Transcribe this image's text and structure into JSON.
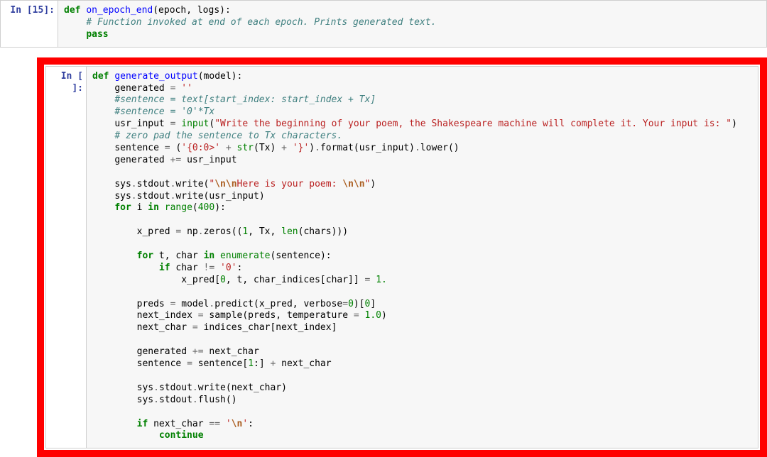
{
  "cells": [
    {
      "prompt": "In [15]:",
      "lines": [
        {
          "t": "l1",
          "indent": 0
        },
        {
          "t": "l2",
          "indent": 4
        },
        {
          "t": "l3",
          "indent": 4
        }
      ]
    },
    {
      "prompt": "In [ ]:",
      "lines": [
        {
          "t": "b1",
          "indent": 0
        },
        {
          "t": "b2",
          "indent": 4
        },
        {
          "t": "b3",
          "indent": 4
        },
        {
          "t": "b4",
          "indent": 4
        },
        {
          "t": "b5",
          "indent": 4
        },
        {
          "t": "b6",
          "indent": 4
        },
        {
          "t": "b7",
          "indent": 4
        },
        {
          "t": "b8",
          "indent": 4
        },
        {
          "t": "blk",
          "indent": 0
        },
        {
          "t": "b9",
          "indent": 4
        },
        {
          "t": "b10",
          "indent": 4
        },
        {
          "t": "b11",
          "indent": 4
        },
        {
          "t": "blk",
          "indent": 0
        },
        {
          "t": "b12",
          "indent": 8
        },
        {
          "t": "blk",
          "indent": 0
        },
        {
          "t": "b13",
          "indent": 8
        },
        {
          "t": "b14",
          "indent": 12
        },
        {
          "t": "b15",
          "indent": 16
        },
        {
          "t": "blk",
          "indent": 0
        },
        {
          "t": "b16",
          "indent": 8
        },
        {
          "t": "b17",
          "indent": 8
        },
        {
          "t": "b18",
          "indent": 8
        },
        {
          "t": "blk",
          "indent": 0
        },
        {
          "t": "b19",
          "indent": 8
        },
        {
          "t": "b20",
          "indent": 8
        },
        {
          "t": "blk",
          "indent": 0
        },
        {
          "t": "b21",
          "indent": 8
        },
        {
          "t": "b22",
          "indent": 8
        },
        {
          "t": "blk",
          "indent": 0
        },
        {
          "t": "b23",
          "indent": 8
        },
        {
          "t": "b24",
          "indent": 12
        }
      ]
    }
  ],
  "tokens": {
    "blk": [],
    "l1": [
      {
        "c": "kw",
        "v": "def"
      },
      {
        "c": "pl",
        "v": " "
      },
      {
        "c": "fn",
        "v": "on_epoch_end"
      },
      {
        "c": "pl",
        "v": "(epoch, logs):"
      }
    ],
    "l2": [
      {
        "c": "cm",
        "v": "# Function invoked at end of each epoch. Prints generated text."
      }
    ],
    "l3": [
      {
        "c": "kw",
        "v": "pass"
      }
    ],
    "b1": [
      {
        "c": "kw",
        "v": "def"
      },
      {
        "c": "pl",
        "v": " "
      },
      {
        "c": "fn",
        "v": "generate_output"
      },
      {
        "c": "pl",
        "v": "(model):"
      }
    ],
    "b2": [
      {
        "c": "pl",
        "v": "generated "
      },
      {
        "c": "pun",
        "v": "="
      },
      {
        "c": "pl",
        "v": " "
      },
      {
        "c": "st",
        "v": "''"
      }
    ],
    "b3": [
      {
        "c": "cm",
        "v": "#sentence = text[start_index: start_index + Tx]"
      }
    ],
    "b4": [
      {
        "c": "cm",
        "v": "#sentence = '0'*Tx"
      }
    ],
    "b5": [
      {
        "c": "pl",
        "v": "usr_input "
      },
      {
        "c": "pun",
        "v": "="
      },
      {
        "c": "pl",
        "v": " "
      },
      {
        "c": "bi",
        "v": "input"
      },
      {
        "c": "pl",
        "v": "("
      },
      {
        "c": "st",
        "v": "\"Write the beginning of your poem, the Shakespeare machine will complete it. Your input is: \""
      },
      {
        "c": "pl",
        "v": ")"
      }
    ],
    "b6": [
      {
        "c": "cm",
        "v": "# zero pad the sentence to Tx characters."
      }
    ],
    "b7": [
      {
        "c": "pl",
        "v": "sentence "
      },
      {
        "c": "pun",
        "v": "="
      },
      {
        "c": "pl",
        "v": " ("
      },
      {
        "c": "st",
        "v": "'{0:0>'"
      },
      {
        "c": "pl",
        "v": " "
      },
      {
        "c": "pun",
        "v": "+"
      },
      {
        "c": "pl",
        "v": " "
      },
      {
        "c": "bi",
        "v": "str"
      },
      {
        "c": "pl",
        "v": "(Tx) "
      },
      {
        "c": "pun",
        "v": "+"
      },
      {
        "c": "pl",
        "v": " "
      },
      {
        "c": "st",
        "v": "'}'"
      },
      {
        "c": "pl",
        "v": ")"
      },
      {
        "c": "pun",
        "v": "."
      },
      {
        "c": "pl",
        "v": "format(usr_input)"
      },
      {
        "c": "pun",
        "v": "."
      },
      {
        "c": "pl",
        "v": "lower()"
      }
    ],
    "b8": [
      {
        "c": "pl",
        "v": "generated "
      },
      {
        "c": "pun",
        "v": "+="
      },
      {
        "c": "pl",
        "v": " usr_input"
      }
    ],
    "b9": [
      {
        "c": "pl",
        "v": "sys"
      },
      {
        "c": "pun",
        "v": "."
      },
      {
        "c": "pl",
        "v": "stdout"
      },
      {
        "c": "pun",
        "v": "."
      },
      {
        "c": "pl",
        "v": "write("
      },
      {
        "c": "st",
        "v": "\""
      },
      {
        "c": "se",
        "v": "\\n\\n"
      },
      {
        "c": "st",
        "v": "Here is your poem: "
      },
      {
        "c": "se",
        "v": "\\n\\n"
      },
      {
        "c": "st",
        "v": "\""
      },
      {
        "c": "pl",
        "v": ")"
      }
    ],
    "b10": [
      {
        "c": "pl",
        "v": "sys"
      },
      {
        "c": "pun",
        "v": "."
      },
      {
        "c": "pl",
        "v": "stdout"
      },
      {
        "c": "pun",
        "v": "."
      },
      {
        "c": "pl",
        "v": "write(usr_input)"
      }
    ],
    "b11": [
      {
        "c": "kw",
        "v": "for"
      },
      {
        "c": "pl",
        "v": " i "
      },
      {
        "c": "kw",
        "v": "in"
      },
      {
        "c": "pl",
        "v": " "
      },
      {
        "c": "bi",
        "v": "range"
      },
      {
        "c": "pl",
        "v": "("
      },
      {
        "c": "num",
        "v": "400"
      },
      {
        "c": "pl",
        "v": "):"
      }
    ],
    "b12": [
      {
        "c": "pl",
        "v": "x_pred "
      },
      {
        "c": "pun",
        "v": "="
      },
      {
        "c": "pl",
        "v": " np"
      },
      {
        "c": "pun",
        "v": "."
      },
      {
        "c": "pl",
        "v": "zeros(("
      },
      {
        "c": "num",
        "v": "1"
      },
      {
        "c": "pl",
        "v": ", Tx, "
      },
      {
        "c": "bi",
        "v": "len"
      },
      {
        "c": "pl",
        "v": "(chars)))"
      }
    ],
    "b13": [
      {
        "c": "kw",
        "v": "for"
      },
      {
        "c": "pl",
        "v": " t, char "
      },
      {
        "c": "kw",
        "v": "in"
      },
      {
        "c": "pl",
        "v": " "
      },
      {
        "c": "bi",
        "v": "enumerate"
      },
      {
        "c": "pl",
        "v": "(sentence):"
      }
    ],
    "b14": [
      {
        "c": "kw",
        "v": "if"
      },
      {
        "c": "pl",
        "v": " char "
      },
      {
        "c": "pun",
        "v": "!="
      },
      {
        "c": "pl",
        "v": " "
      },
      {
        "c": "st",
        "v": "'0'"
      },
      {
        "c": "pl",
        "v": ":"
      }
    ],
    "b15": [
      {
        "c": "pl",
        "v": "x_pred["
      },
      {
        "c": "num",
        "v": "0"
      },
      {
        "c": "pl",
        "v": ", t, char_indices[char]] "
      },
      {
        "c": "pun",
        "v": "="
      },
      {
        "c": "pl",
        "v": " "
      },
      {
        "c": "num",
        "v": "1."
      }
    ],
    "b16": [
      {
        "c": "pl",
        "v": "preds "
      },
      {
        "c": "pun",
        "v": "="
      },
      {
        "c": "pl",
        "v": " model"
      },
      {
        "c": "pun",
        "v": "."
      },
      {
        "c": "pl",
        "v": "predict(x_pred, verbose"
      },
      {
        "c": "pun",
        "v": "="
      },
      {
        "c": "num",
        "v": "0"
      },
      {
        "c": "pl",
        "v": ")["
      },
      {
        "c": "num",
        "v": "0"
      },
      {
        "c": "pl",
        "v": "]"
      }
    ],
    "b17": [
      {
        "c": "pl",
        "v": "next_index "
      },
      {
        "c": "pun",
        "v": "="
      },
      {
        "c": "pl",
        "v": " sample(preds, temperature "
      },
      {
        "c": "pun",
        "v": "="
      },
      {
        "c": "pl",
        "v": " "
      },
      {
        "c": "num",
        "v": "1.0"
      },
      {
        "c": "pl",
        "v": ")"
      }
    ],
    "b18": [
      {
        "c": "pl",
        "v": "next_char "
      },
      {
        "c": "pun",
        "v": "="
      },
      {
        "c": "pl",
        "v": " indices_char[next_index]"
      }
    ],
    "b19": [
      {
        "c": "pl",
        "v": "generated "
      },
      {
        "c": "pun",
        "v": "+="
      },
      {
        "c": "pl",
        "v": " next_char"
      }
    ],
    "b20": [
      {
        "c": "pl",
        "v": "sentence "
      },
      {
        "c": "pun",
        "v": "="
      },
      {
        "c": "pl",
        "v": " sentence["
      },
      {
        "c": "num",
        "v": "1"
      },
      {
        "c": "pl",
        "v": ":] "
      },
      {
        "c": "pun",
        "v": "+"
      },
      {
        "c": "pl",
        "v": " next_char"
      }
    ],
    "b21": [
      {
        "c": "pl",
        "v": "sys"
      },
      {
        "c": "pun",
        "v": "."
      },
      {
        "c": "pl",
        "v": "stdout"
      },
      {
        "c": "pun",
        "v": "."
      },
      {
        "c": "pl",
        "v": "write(next_char)"
      }
    ],
    "b22": [
      {
        "c": "pl",
        "v": "sys"
      },
      {
        "c": "pun",
        "v": "."
      },
      {
        "c": "pl",
        "v": "stdout"
      },
      {
        "c": "pun",
        "v": "."
      },
      {
        "c": "pl",
        "v": "flush()"
      }
    ],
    "b23": [
      {
        "c": "kw",
        "v": "if"
      },
      {
        "c": "pl",
        "v": " next_char "
      },
      {
        "c": "pun",
        "v": "=="
      },
      {
        "c": "pl",
        "v": " "
      },
      {
        "c": "st",
        "v": "'"
      },
      {
        "c": "se",
        "v": "\\n"
      },
      {
        "c": "st",
        "v": "'"
      },
      {
        "c": "pl",
        "v": ":"
      }
    ],
    "b24": [
      {
        "c": "kw",
        "v": "continue"
      }
    ]
  }
}
